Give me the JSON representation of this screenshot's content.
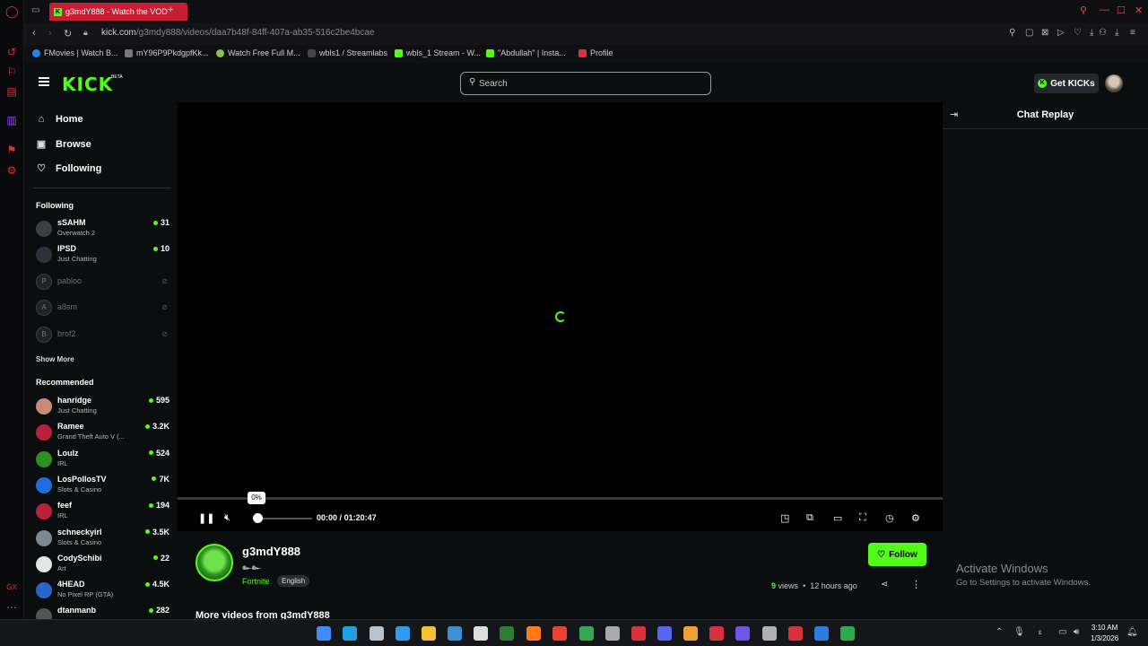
{
  "browser": {
    "tab_title": "g3mdY888 - Watch the VOD",
    "tab_favicon": "K",
    "new_tab": "+",
    "url_host": "kick.com",
    "url_path": "/g3mdy888/videos/daa7b48f-84ff-407a-ab35-516c2be4bcae"
  },
  "bookmarks": [
    {
      "label": "FMovies | Watch B...",
      "color": "#1e88e5"
    },
    {
      "label": "mY96P9PkdgpfKk...",
      "color": "#777777"
    },
    {
      "label": "Watch Free Full M...",
      "color": "#8bc34a"
    },
    {
      "label": "wbls1 / Streamlabs",
      "color": "#444444"
    },
    {
      "label": "wbls_1 Stream - W...",
      "color": "#53fc18"
    },
    {
      "label": "\"Abdullah\" | Insta...",
      "color": "#53fc18"
    },
    {
      "label": "Profile",
      "color": "#d8323f"
    }
  ],
  "header": {
    "logo": "KICK",
    "beta": "BETA",
    "search_placeholder": "Search",
    "get_kicks": "Get KICKs"
  },
  "nav": [
    {
      "label": "Home",
      "icon": "home-icon",
      "glyph": "⌂"
    },
    {
      "label": "Browse",
      "icon": "browse-icon",
      "glyph": "▣"
    },
    {
      "label": "Following",
      "icon": "heart-icon",
      "glyph": "♡"
    }
  ],
  "following": {
    "title": "Following",
    "channels": [
      {
        "name": "sSAHM",
        "category": "Overwatch 2",
        "viewers": "31",
        "live": true,
        "color": "#3a3f46"
      },
      {
        "name": "IPSD",
        "category": "Just Chatting",
        "viewers": "10",
        "live": true,
        "color": "#2e3238"
      },
      {
        "name": "pabloo",
        "live": false,
        "glyph": "P"
      },
      {
        "name": "a8sm",
        "live": false,
        "glyph": "A"
      },
      {
        "name": "brof2",
        "live": false,
        "glyph": "B"
      }
    ],
    "show_more": "Show More"
  },
  "recommended": {
    "title": "Recommended",
    "channels": [
      {
        "name": "hanridge",
        "category": "Just Chatting",
        "viewers": "595",
        "color": "#c98a7a"
      },
      {
        "name": "Ramee",
        "category": "Grand Theft Auto V (...",
        "viewers": "3.2K",
        "color": "#b8223a"
      },
      {
        "name": "Loulz",
        "category": "IRL",
        "viewers": "524",
        "color": "#2f8f25"
      },
      {
        "name": "LosPollosTV",
        "category": "Slots & Casino",
        "viewers": "7K",
        "color": "#1e6fd9"
      },
      {
        "name": "feef",
        "category": "IRL",
        "viewers": "194",
        "color": "#b8223a"
      },
      {
        "name": "schneckyirl",
        "category": "Slots & Casino",
        "viewers": "3.5K",
        "color": "#7d8894"
      },
      {
        "name": "CodySchibi",
        "category": "Art",
        "viewers": "22",
        "color": "#e5e5e5"
      },
      {
        "name": "4HEAD",
        "category": "No Pixel RP (GTA)",
        "viewers": "4.5K",
        "color": "#2a66c9"
      },
      {
        "name": "dtanmanb",
        "category": "",
        "viewers": "282",
        "color": "#555555"
      }
    ]
  },
  "player": {
    "seek_percent_label": "0%",
    "progress": 0.0,
    "volume": 0.0,
    "current_time": "00:00",
    "separator": "/",
    "duration": "01:20:47"
  },
  "video": {
    "channel_name": "g3mdY888",
    "channel_subtitle": "๛๛",
    "category": "Fortnite",
    "language": "English",
    "follow_label": "Follow",
    "views_count": "9",
    "views_label": "views",
    "dot": "•",
    "age": "12 hours ago",
    "more_heading": "More videos from g3mdY888"
  },
  "chat": {
    "title": "Chat Replay"
  },
  "watermark": {
    "line1": "Activate Windows",
    "line2": "Go to Settings to activate Windows."
  },
  "taskbar": {
    "time": "3:10 AM",
    "date": "1/3/2026",
    "icons": [
      {
        "name": "windows-start-icon",
        "color": "#3d8bff"
      },
      {
        "name": "edge-icon",
        "color": "#1fa2e0"
      },
      {
        "name": "steam-icon",
        "color": "#b7c3cf"
      },
      {
        "name": "store-icon",
        "color": "#2f9cf0"
      },
      {
        "name": "explorer-icon",
        "color": "#f2c230"
      },
      {
        "name": "app-icon",
        "color": "#3a8fd6"
      },
      {
        "name": "epic-icon",
        "color": "#ddd"
      },
      {
        "name": "app-icon",
        "color": "#2e7d32"
      },
      {
        "name": "soundcloud-icon",
        "color": "#ff7a1a"
      },
      {
        "name": "chrome-icon",
        "color": "#e94235"
      },
      {
        "name": "chrome-icon",
        "color": "#34a853"
      },
      {
        "name": "app-icon",
        "color": "#aaa"
      },
      {
        "name": "opera-icon",
        "color": "#d8323f"
      },
      {
        "name": "discord-icon",
        "color": "#5865f2"
      },
      {
        "name": "app-icon",
        "color": "#f0a030"
      },
      {
        "name": "app-icon",
        "color": "#d8323f"
      },
      {
        "name": "app-icon",
        "color": "#6f55e8"
      },
      {
        "name": "app-icon",
        "color": "#b0b0b0"
      },
      {
        "name": "app-icon",
        "color": "#d8323f"
      },
      {
        "name": "app-icon",
        "color": "#2a7de1"
      },
      {
        "name": "xbox-icon",
        "color": "#2fa84f"
      }
    ]
  }
}
